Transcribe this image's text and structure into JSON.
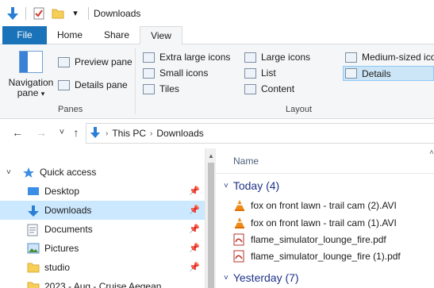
{
  "titlebar": {
    "title": "Downloads",
    "icons": [
      "down-arrow-icon",
      "properties-icon",
      "folder-icon",
      "customize-chevron-icon"
    ],
    "customize_glyph": "▾"
  },
  "ribbon_tabs": [
    {
      "label": "File"
    },
    {
      "label": "Home"
    },
    {
      "label": "Share"
    },
    {
      "label": "View"
    }
  ],
  "ribbon": {
    "panes": {
      "navigation_pane_label_1": "Navigation",
      "navigation_pane_label_2": "pane",
      "navigation_pane_caret": "▾",
      "preview_pane": "Preview pane",
      "details_pane": "Details pane",
      "group_label": "Panes"
    },
    "layout": {
      "extra_large_icons": "Extra large icons",
      "large_icons": "Large icons",
      "medium_icons": "Medium-sized ico",
      "small_icons": "Small icons",
      "list": "List",
      "details": "Details",
      "tiles": "Tiles",
      "content": "Content",
      "group_label": "Layout",
      "selected": "Details"
    }
  },
  "address": {
    "back_glyph": "←",
    "forward_glyph": "→",
    "recent_glyph": "˅",
    "up_glyph": "↑",
    "crumbs": [
      "This PC",
      "Downloads"
    ],
    "separator": "›"
  },
  "nav_tree": {
    "quick_access": "Quick access",
    "items": [
      {
        "label": "Desktop",
        "icon": "desktop-icon",
        "pinned": true
      },
      {
        "label": "Downloads",
        "icon": "downloads-icon",
        "pinned": true,
        "selected": true
      },
      {
        "label": "Documents",
        "icon": "documents-icon",
        "pinned": true
      },
      {
        "label": "Pictures",
        "icon": "pictures-icon",
        "pinned": true
      },
      {
        "label": "studio",
        "icon": "folder-icon",
        "pinned": true
      },
      {
        "label": "2023 - Aug - Cruise Aegean",
        "icon": "folder-icon",
        "pinned": false
      }
    ]
  },
  "content": {
    "column_name": "Name",
    "groups": [
      {
        "label": "Today (4)",
        "files": [
          {
            "name": "fox on front lawn - trail cam (2).AVI",
            "icon": "vlc-icon"
          },
          {
            "name": "fox on front lawn - trail cam (1).AVI",
            "icon": "vlc-icon"
          },
          {
            "name": "flame_simulator_lounge_fire.pdf",
            "icon": "pdf-icon"
          },
          {
            "name": "flame_simulator_lounge_fire (1).pdf",
            "icon": "pdf-icon"
          }
        ]
      },
      {
        "label": "Yesterday (7)",
        "files": []
      }
    ]
  },
  "colors": {
    "accent": "#1a73b8",
    "selection": "#cce8ff",
    "group_header": "#1e3287"
  }
}
